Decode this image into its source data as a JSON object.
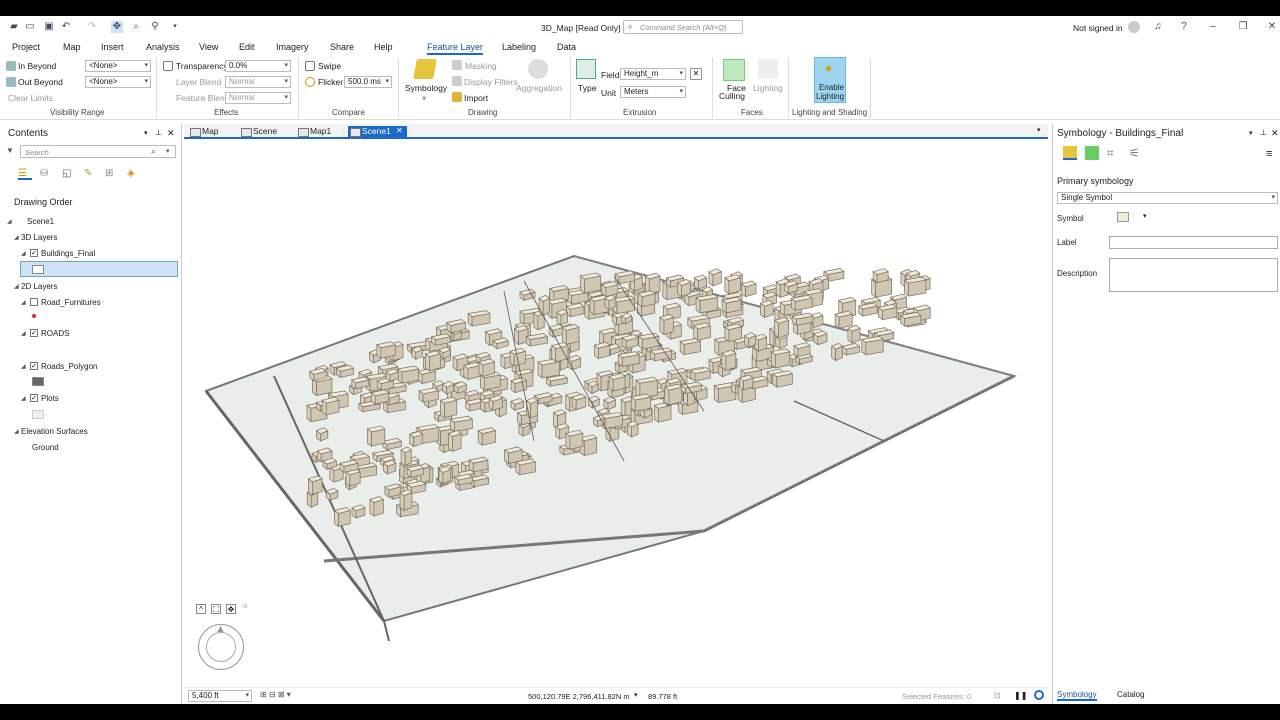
{
  "window": {
    "title": "3D_Map [Read Only]",
    "search_placeholder": "Command Search (Alt+Q)",
    "signin": "Not signed in"
  },
  "ribbon": {
    "tabs": [
      "Project",
      "Map",
      "Insert",
      "Analysis",
      "View",
      "Edit",
      "Imagery",
      "Share",
      "Help"
    ],
    "context_tabs": [
      "Feature Layer",
      "Labeling",
      "Data"
    ],
    "visibility": {
      "in_beyond": "In Beyond",
      "out_beyond": "Out Beyond",
      "in_value": "<None>",
      "out_value": "<None>",
      "clear": "Clear Limits",
      "group": "Visibility Range"
    },
    "effects": {
      "transparency": "Transparency",
      "transparency_value": "0.0%",
      "layer_blend": "Layer Blend",
      "layer_blend_value": "Normal",
      "feature_blend": "Feature Blend",
      "feature_blend_value": "Normal",
      "group": "Effects"
    },
    "compare": {
      "swipe": "Swipe",
      "flicker": "Flicker",
      "flicker_value": "500.0 ms",
      "group": "Compare"
    },
    "drawing": {
      "symbology": "Symbology",
      "masking": "Masking",
      "display_filters": "Display Filters",
      "import": "Import",
      "aggregation": "Aggregation",
      "group": "Drawing"
    },
    "extrusion": {
      "type": "Type",
      "field": "Field",
      "field_value": "Height_m",
      "unit": "Unit",
      "unit_value": "Meters",
      "group": "Extrusion"
    },
    "faces": {
      "face_culling_1": "Face",
      "face_culling_2": "Culling",
      "lighting": "Lighting",
      "group": "Faces"
    },
    "lighting": {
      "enable_1": "Enable",
      "enable_2": "Lighting",
      "group": "Lighting and Shading"
    }
  },
  "contents": {
    "title": "Contents",
    "search_placeholder": "Search",
    "drawing_order": "Drawing Order",
    "scene": "Scene1",
    "layers3d": "3D Layers",
    "buildings": "Buildings_Final",
    "layers2d": "2D Layers",
    "road_furn": "Road_Furnitures",
    "roads": "ROADS",
    "roads_poly": "Roads_Polygon",
    "plots": "Plots",
    "elev": "Elevation Surfaces",
    "ground": "Ground"
  },
  "view": {
    "tabs": [
      "Map",
      "Scene",
      "Map1",
      "Scene1"
    ],
    "scale": "5,400 ft",
    "coords": "500,120.79E 2,796,411.82N m",
    "elevation": "89.778 ft",
    "selected": "Selected Features: 0"
  },
  "symbology": {
    "title": "Symbology - Buildings_Final",
    "primary": "Primary symbology",
    "primary_value": "Single Symbol",
    "symbol": "Symbol",
    "label": "Label",
    "description": "Description",
    "bottom_tabs": [
      "Symbology",
      "Catalog"
    ]
  },
  "colors": {
    "accent": "#1b6ac9",
    "selected_row": "#cfe3f7",
    "building_fill": "#efe8d8",
    "lighting_btn": "#9fd4f0"
  }
}
